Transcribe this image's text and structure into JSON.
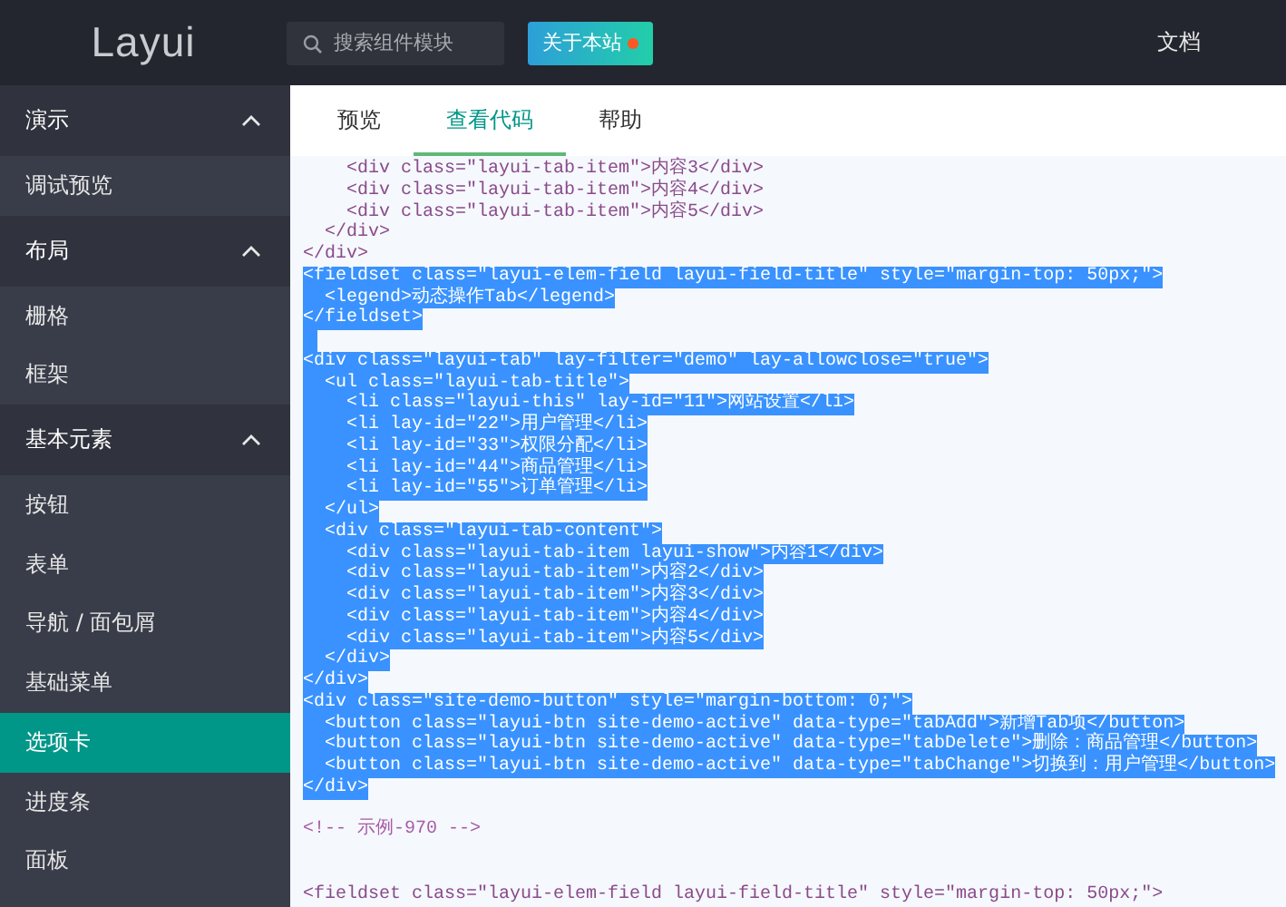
{
  "header": {
    "logo": "Layui",
    "search": {
      "placeholder": "搜索组件模块"
    },
    "about_button": {
      "label": "关于本站"
    },
    "nav_link": "文档"
  },
  "sidebar": {
    "groups": [
      {
        "label": "演示",
        "expanded": true,
        "items": [
          {
            "label": "调试预览",
            "selected": false
          }
        ]
      },
      {
        "label": "布局",
        "expanded": true,
        "items": [
          {
            "label": "栅格",
            "selected": false
          },
          {
            "label": "框架",
            "selected": false
          }
        ]
      },
      {
        "label": "基本元素",
        "expanded": true,
        "items": [
          {
            "label": "按钮",
            "selected": false
          },
          {
            "label": "表单",
            "selected": false
          },
          {
            "label": "导航 / 面包屑",
            "selected": false
          },
          {
            "label": "基础菜单",
            "selected": false
          },
          {
            "label": "选项卡",
            "selected": true
          },
          {
            "label": "进度条",
            "selected": false
          },
          {
            "label": "面板",
            "selected": false
          }
        ]
      }
    ]
  },
  "tabs": [
    {
      "label": "预览",
      "selected": false
    },
    {
      "label": "查看代码",
      "selected": true
    },
    {
      "label": "帮助",
      "selected": false
    }
  ],
  "code_lines": [
    {
      "kind": "code",
      "text": "    <div class=\"layui-tab-item\">内容3</div>",
      "selected": false
    },
    {
      "kind": "code",
      "text": "    <div class=\"layui-tab-item\">内容4</div>",
      "selected": false
    },
    {
      "kind": "code",
      "text": "    <div class=\"layui-tab-item\">内容5</div>",
      "selected": false
    },
    {
      "kind": "code",
      "text": "  </div>",
      "selected": false
    },
    {
      "kind": "code",
      "text": "</div>",
      "selected": false
    },
    {
      "kind": "code",
      "text": "<fieldset class=\"layui-elem-field layui-field-title\" style=\"margin-top: 50px;\">",
      "selected": true
    },
    {
      "kind": "code",
      "text": "  <legend>动态操作Tab</legend>",
      "selected": true
    },
    {
      "kind": "code",
      "text": "</fieldset>",
      "selected": true
    },
    {
      "kind": "blank",
      "selected": true
    },
    {
      "kind": "code",
      "text": "<div class=\"layui-tab\" lay-filter=\"demo\" lay-allowclose=\"true\">",
      "selected": true
    },
    {
      "kind": "code",
      "text": "  <ul class=\"layui-tab-title\">",
      "selected": true
    },
    {
      "kind": "code",
      "text": "    <li class=\"layui-this\" lay-id=\"11\">网站设置</li>",
      "selected": true
    },
    {
      "kind": "code",
      "text": "    <li lay-id=\"22\">用户管理</li>",
      "selected": true
    },
    {
      "kind": "code",
      "text": "    <li lay-id=\"33\">权限分配</li>",
      "selected": true
    },
    {
      "kind": "code",
      "text": "    <li lay-id=\"44\">商品管理</li>",
      "selected": true
    },
    {
      "kind": "code",
      "text": "    <li lay-id=\"55\">订单管理</li>",
      "selected": true
    },
    {
      "kind": "code",
      "text": "  </ul>",
      "selected": true
    },
    {
      "kind": "code",
      "text": "  <div class=\"layui-tab-content\">",
      "selected": true
    },
    {
      "kind": "code",
      "text": "    <div class=\"layui-tab-item layui-show\">内容1</div>",
      "selected": true
    },
    {
      "kind": "code",
      "text": "    <div class=\"layui-tab-item\">内容2</div>",
      "selected": true
    },
    {
      "kind": "code",
      "text": "    <div class=\"layui-tab-item\">内容3</div>",
      "selected": true
    },
    {
      "kind": "code",
      "text": "    <div class=\"layui-tab-item\">内容4</div>",
      "selected": true
    },
    {
      "kind": "code",
      "text": "    <div class=\"layui-tab-item\">内容5</div>",
      "selected": true
    },
    {
      "kind": "code",
      "text": "  </div>",
      "selected": true
    },
    {
      "kind": "code",
      "text": "</div>",
      "selected": true
    },
    {
      "kind": "code",
      "text": "<div class=\"site-demo-button\" style=\"margin-bottom: 0;\">",
      "selected": true
    },
    {
      "kind": "code",
      "text": "  <button class=\"layui-btn site-demo-active\" data-type=\"tabAdd\">新增Tab项</button>",
      "selected": true
    },
    {
      "kind": "code",
      "text": "  <button class=\"layui-btn site-demo-active\" data-type=\"tabDelete\">删除：商品管理</button>",
      "selected": true
    },
    {
      "kind": "code",
      "text": "  <button class=\"layui-btn site-demo-active\" data-type=\"tabChange\">切换到：用户管理</button>",
      "selected": true
    },
    {
      "kind": "code",
      "text": "</div>",
      "selected": true
    },
    {
      "kind": "blank",
      "selected": false
    },
    {
      "kind": "comment",
      "text": "<!-- 示例-970 -->",
      "selected": false
    },
    {
      "kind": "blank",
      "selected": false
    },
    {
      "kind": "blank",
      "selected": false
    },
    {
      "kind": "code",
      "text": "<fieldset class=\"layui-elem-field layui-field-title\" style=\"margin-top: 50px;\">",
      "selected": false
    }
  ]
}
